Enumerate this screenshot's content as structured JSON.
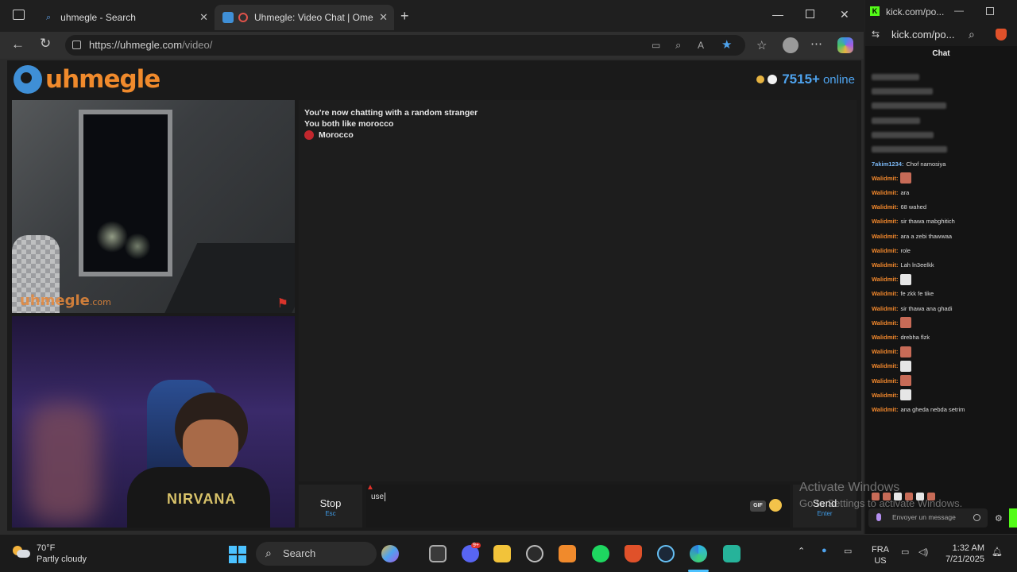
{
  "browser": {
    "tabs": [
      {
        "title": "uhmegle - Search"
      },
      {
        "title": "Uhmegle: Video Chat | Ome"
      }
    ],
    "url_host": "https://uhmegle.com",
    "url_path": "/video/"
  },
  "page": {
    "logo_text": "uhmegle",
    "online_count": "7515+",
    "online_label": "online",
    "watermark_main": "uhmegle",
    "watermark_suffix": ".com",
    "messages": [
      "You're now chatting with a random stranger",
      "You both like morocco"
    ],
    "country": "Morocco",
    "stop_label": "Stop",
    "stop_key": "Esc",
    "input_value": "use",
    "gif_label": "GIF",
    "send_label": "Send",
    "send_key": "Enter",
    "shirt_print": "NIRVANA"
  },
  "activation": {
    "title": "Activate Windows",
    "subtitle": "Go to Settings to activate Windows."
  },
  "kick": {
    "window_title": "kick.com/po...",
    "address": "kick.com/po...",
    "chat_header": "Chat",
    "messages": [
      {
        "user": "",
        "text": "",
        "blurred": true
      },
      {
        "user": "",
        "text": "",
        "blurred": true
      },
      {
        "user": "",
        "text": "",
        "blurred": true
      },
      {
        "user": "",
        "text": "",
        "blurred": true
      },
      {
        "user": "",
        "text": "",
        "blurred": true
      },
      {
        "user": "",
        "text": "",
        "blurred": true
      },
      {
        "user": "7akim1234:",
        "text": "Chof namosiya",
        "blue": true
      },
      {
        "user": "Walidmit:",
        "emote": "r"
      },
      {
        "user": "Walidmit:",
        "text": "ara"
      },
      {
        "user": "Walidmit:",
        "text": "68 wahed"
      },
      {
        "user": "Walidmit:",
        "text": "sir thawa mabghitich"
      },
      {
        "user": "Walidmit:",
        "text": "ara a zebi thawwaa"
      },
      {
        "user": "Walidmit:",
        "text": "role"
      },
      {
        "user": "Walidmit:",
        "text": "Lah ln3eelkk"
      },
      {
        "user": "Walidmit:",
        "emote": "w"
      },
      {
        "user": "Walidmit:",
        "text": "fe zkk fe tike"
      },
      {
        "user": "Walidmit:",
        "text": "sir thawa ana ghadi"
      },
      {
        "user": "Walidmit:",
        "emote": "r"
      },
      {
        "user": "Walidmit:",
        "text": "drebha flzk"
      },
      {
        "user": "Walidmit:",
        "emote": "r"
      },
      {
        "user": "Walidmit:",
        "emote": "w"
      },
      {
        "user": "Walidmit:",
        "emote": "r"
      },
      {
        "user": "Walidmit:",
        "emote": "w"
      },
      {
        "user": "Walidmit:",
        "text": "ana gheda nebda setrim"
      }
    ],
    "input_placeholder": "Envoyer un message"
  },
  "taskbar": {
    "weather_temp": "70°F",
    "weather_desc": "Partly cloudy",
    "search_label": "Search",
    "lang_1": "FRA",
    "lang_2": "US",
    "time": "1:32 AM",
    "date": "7/21/2025",
    "discord_badge": "9+"
  },
  "colors": {
    "accent_blue": "#4ea3ee",
    "logo_orange": "#f08a2c",
    "kick_green": "#53fc18"
  }
}
